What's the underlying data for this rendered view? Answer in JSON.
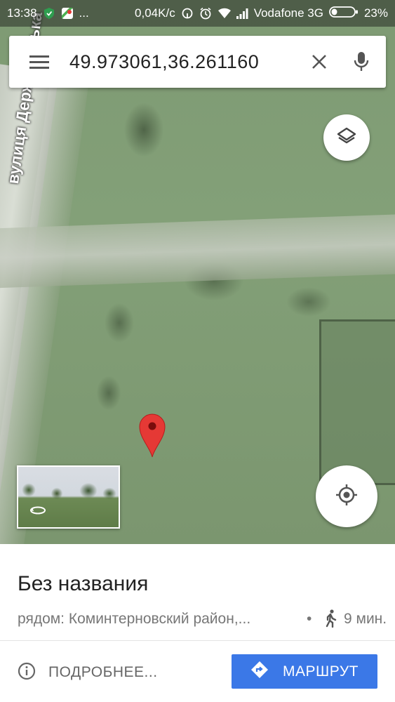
{
  "status_bar": {
    "time": "13:38",
    "speed": "0,04K/c",
    "carrier": "Vodafone 3G",
    "battery": "23%",
    "more": "..."
  },
  "search": {
    "query": "49.973061,36.261160",
    "menu_icon": "hamburger-icon",
    "clear_icon": "close-icon",
    "mic_icon": "mic-icon"
  },
  "map": {
    "street_label": "вулиця Державінська",
    "layers_icon": "layers-icon",
    "my_location_icon": "my-location-icon",
    "pin_color": "#e53935"
  },
  "place": {
    "title": "Без названия",
    "subtitle": "рядом: Коминтерновский район,...",
    "separator": "•",
    "walk_time": "9 мин."
  },
  "actions": {
    "details_label": "ПОДРОБНЕЕ...",
    "route_label": "МАРШРУТ",
    "route_color": "#3b78e7"
  }
}
